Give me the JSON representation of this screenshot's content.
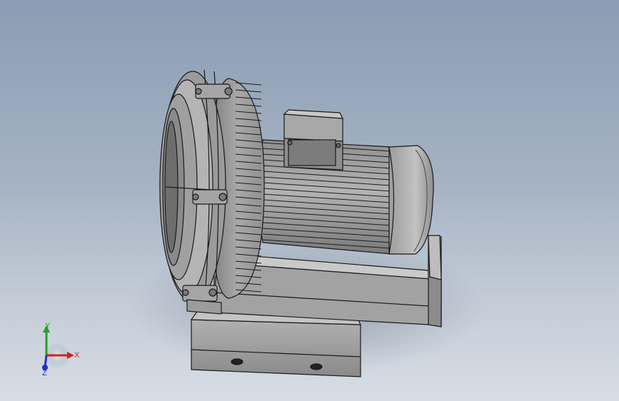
{
  "viewport": {
    "background_top": "#8c9db3",
    "background_bottom": "#d8dde4"
  },
  "model": {
    "part": "side-channel-blower-assembly",
    "body_color": "#9a9a9a",
    "edge_color": "#1a1a1a"
  },
  "triad": {
    "x_label": "X",
    "y_label": "Y",
    "z_label": "Z",
    "x_color": "#d22020",
    "y_color": "#1fa31f",
    "z_color": "#2030c8"
  }
}
